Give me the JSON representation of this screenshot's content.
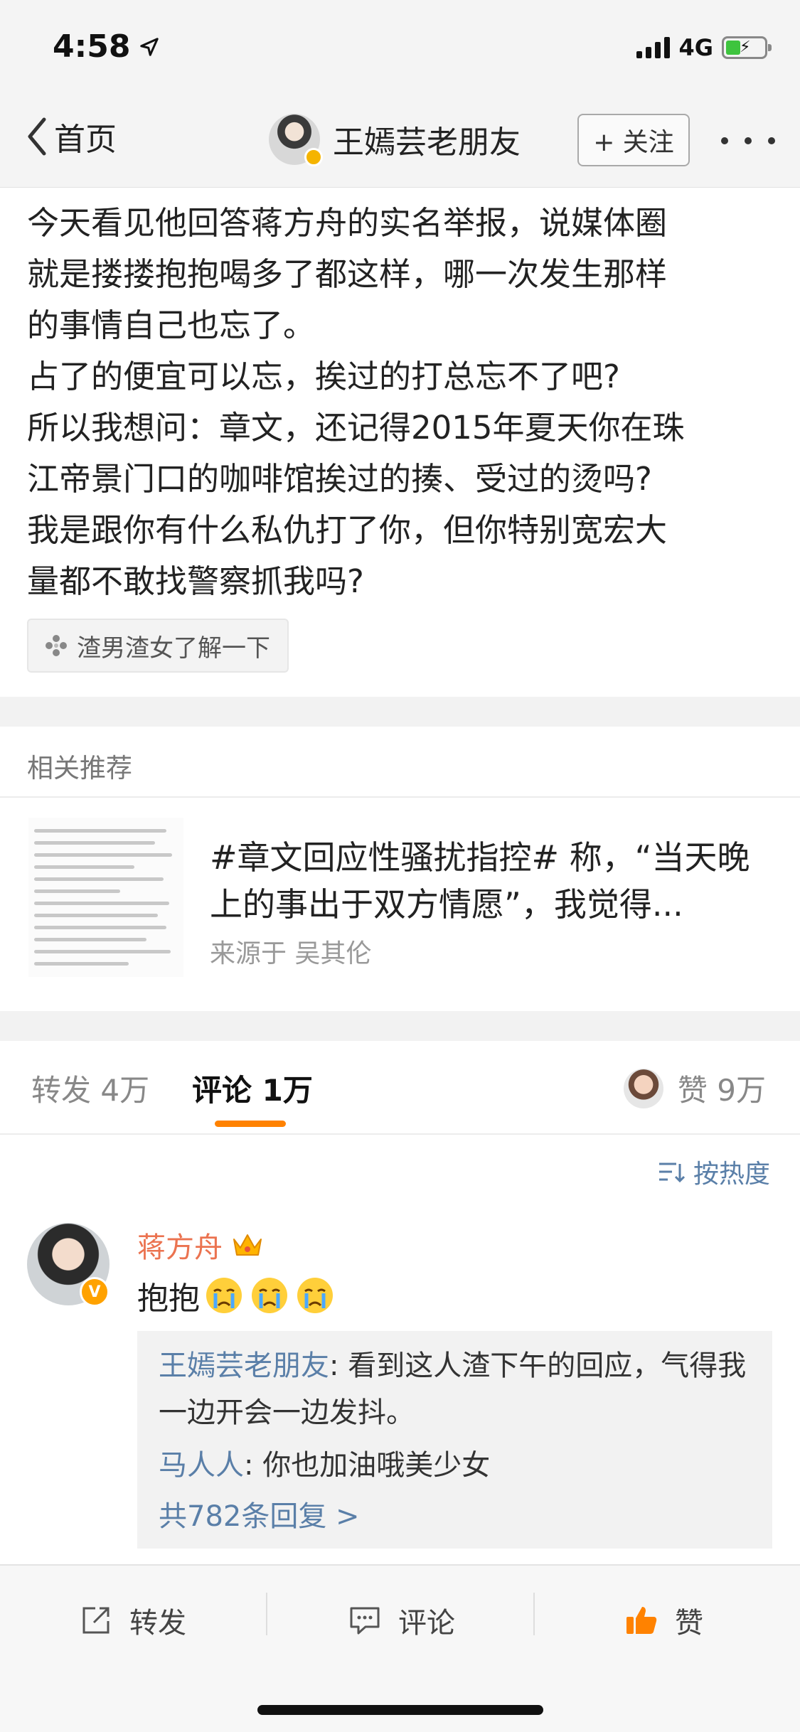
{
  "status_bar": {
    "time": "4:58",
    "network": "4G"
  },
  "nav": {
    "back_label": "首页",
    "user_name": "王嫣芸老朋友",
    "follow_label": "+ 关注"
  },
  "post": {
    "text": "今天看见他回答蒋方舟的实名举报，说媒体圈\n就是搂搂抱抱喝多了都这样，哪一次发生那样\n的事情自己也忘了。\n占了的便宜可以忘，挨过的打总忘不了吧?\n所以我想问：章文，还记得2015年夏天你在珠\n江帝景门口的咖啡馆挨过的揍、受过的烫吗?\n我是跟你有什么私仇打了你，但你特别宽宏大\n量都不敢找警察抓我吗?",
    "topic": "渣男渣女了解一下"
  },
  "related": {
    "title": "相关推荐",
    "text": "#章文回应性骚扰指控# 称，“当天晚上的事出于双方情愿”，我觉得...",
    "source": "来源于 吴其伦"
  },
  "tabs": {
    "repost": "转发 4万",
    "comment": "评论 1万",
    "like": "赞 9万"
  },
  "sort_label": "按热度",
  "comment": {
    "user": "蒋方舟",
    "text": "抱抱",
    "vbadge": "V",
    "replies": [
      {
        "user": "王嫣芸老朋友",
        "text": ": 看到这人渣下午的回应，气得我一边开会一边发抖。"
      },
      {
        "user": "马人人",
        "text": ": 你也加油哦美少女"
      }
    ],
    "more_replies": "共782条回复 >"
  },
  "bottom_bar": {
    "repost": "转发",
    "comment": "评论",
    "like": "赞"
  },
  "colors": {
    "accent": "#ff8200",
    "link": "#5a7fa8",
    "username": "#eb7350"
  }
}
